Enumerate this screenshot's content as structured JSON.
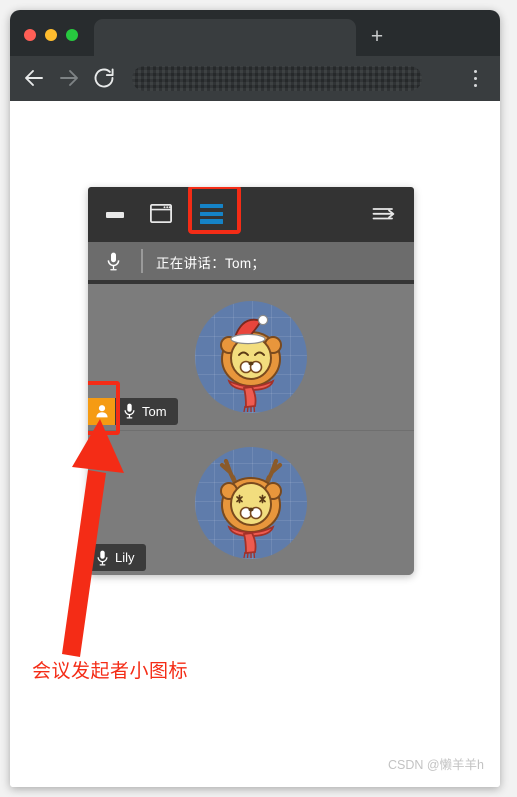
{
  "browser": {
    "traffic_lights": [
      {
        "name": "close",
        "color": "#ff5f56"
      },
      {
        "name": "minimize",
        "color": "#ffbd2e"
      },
      {
        "name": "maximize",
        "color": "#27c93f"
      }
    ],
    "tab": {
      "title": ""
    },
    "new_tab_label": "+",
    "nav": {
      "back_icon": "arrow-left-icon",
      "forward_icon": "arrow-right-icon",
      "reload_icon": "reload-icon",
      "menu_icon": "kebab-menu-icon"
    },
    "url_bar": {
      "value": "",
      "placeholder": "",
      "state": "redacted"
    }
  },
  "meeting": {
    "toolbar": {
      "minimize_label": "",
      "gallery_view_label": "",
      "list_view_label": "",
      "leave_label": "",
      "icons": [
        "minimize-icon",
        "gallery-view-icon",
        "list-view-icon",
        "leave-meeting-icon"
      ],
      "active_view": "list-view",
      "accent_color": "#1583c7"
    },
    "status": {
      "mic_icon": "microphone-icon",
      "text": "正在讲话：Tom；"
    },
    "participants": [
      {
        "name": "Tom",
        "is_host": true,
        "host_icon": "person-badge-icon",
        "mic_icon": "microphone-icon",
        "avatar": "bear-santa-hat-avatar",
        "avatar_bg": "#5f7cab"
      },
      {
        "name": "Lily",
        "is_host": false,
        "host_icon": "",
        "mic_icon": "microphone-icon",
        "avatar": "bear-antlers-avatar",
        "avatar_bg": "#5f7cab"
      }
    ]
  },
  "annotations": {
    "highlight_color": "#f42c16",
    "caption": "会议发起者小图标",
    "arrow_icon": "red-arrow-up-icon",
    "boxes": [
      "list-view-icon",
      "host-badge-icon"
    ]
  },
  "watermark": {
    "text": "CSDN @懒羊羊h"
  }
}
